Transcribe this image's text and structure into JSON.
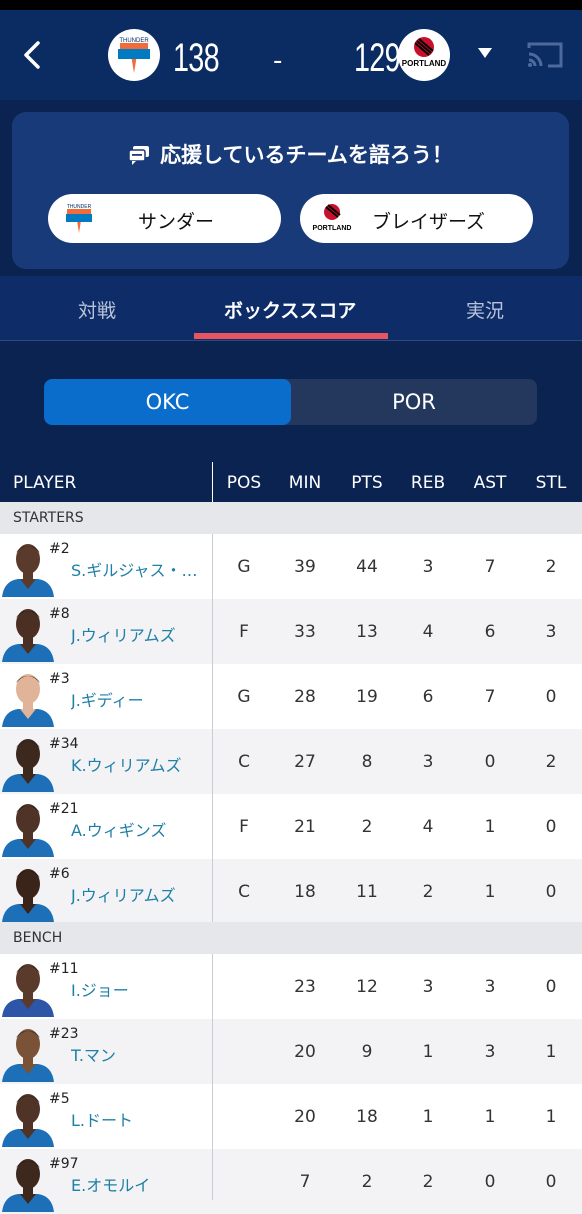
{
  "header": {
    "home_score": "138",
    "separator": "-",
    "away_score": "129",
    "home_logo_text": "THUNDER",
    "away_logo_text": "PORTLAND"
  },
  "cheer": {
    "title": "応援しているチームを語ろう！",
    "home_button": "サンダー",
    "away_button": "ブレイザーズ"
  },
  "tabs": [
    "対戦",
    "ボックススコア",
    "実況"
  ],
  "team_toggle": {
    "selected": "OKC",
    "other": "POR"
  },
  "table": {
    "columns": [
      "PLAYER",
      "POS",
      "MIN",
      "PTS",
      "REB",
      "AST",
      "STL"
    ],
    "starters_label": "STARTERS",
    "bench_label": "BENCH",
    "starters": [
      {
        "num": "#2",
        "name": "S.ギルジャス・…",
        "pos": "G",
        "min": "39",
        "pts": "44",
        "reb": "3",
        "ast": "7",
        "stl": "2",
        "skin": "#5a3a2a",
        "jersey": "#1d6fb8"
      },
      {
        "num": "#8",
        "name": "J.ウィリアムズ",
        "pos": "F",
        "min": "33",
        "pts": "13",
        "reb": "4",
        "ast": "6",
        "stl": "3",
        "skin": "#4a2f22",
        "jersey": "#1d6fb8"
      },
      {
        "num": "#3",
        "name": "J.ギディー",
        "pos": "G",
        "min": "28",
        "pts": "19",
        "reb": "6",
        "ast": "7",
        "stl": "0",
        "skin": "#e1b49a",
        "jersey": "#1d6fb8"
      },
      {
        "num": "#34",
        "name": "K.ウィリアムズ",
        "pos": "C",
        "min": "27",
        "pts": "8",
        "reb": "3",
        "ast": "0",
        "stl": "2",
        "skin": "#3d281e",
        "jersey": "#1d6fb8"
      },
      {
        "num": "#21",
        "name": "A.ウィギンズ",
        "pos": "F",
        "min": "21",
        "pts": "2",
        "reb": "4",
        "ast": "1",
        "stl": "0",
        "skin": "#4e3326",
        "jersey": "#1d6fb8"
      },
      {
        "num": "#6",
        "name": "J.ウィリアムズ",
        "pos": "C",
        "min": "18",
        "pts": "11",
        "reb": "2",
        "ast": "1",
        "stl": "0",
        "skin": "#3a241a",
        "jersey": "#1d6fb8"
      }
    ],
    "bench": [
      {
        "num": "#11",
        "name": "I.ジョー",
        "pos": "",
        "min": "23",
        "pts": "12",
        "reb": "3",
        "ast": "3",
        "stl": "0",
        "skin": "#5a3a2a",
        "jersey": "#2d55a8"
      },
      {
        "num": "#23",
        "name": "T.マン",
        "pos": "",
        "min": "20",
        "pts": "9",
        "reb": "1",
        "ast": "3",
        "stl": "1",
        "skin": "#7a5238",
        "jersey": "#1d6fb8"
      },
      {
        "num": "#5",
        "name": "L.ドート",
        "pos": "",
        "min": "20",
        "pts": "18",
        "reb": "1",
        "ast": "1",
        "stl": "1",
        "skin": "#4e3326",
        "jersey": "#1d6fb8"
      },
      {
        "num": "#97",
        "name": "E.オモルイ",
        "pos": "",
        "min": "7",
        "pts": "2",
        "reb": "2",
        "ast": "0",
        "stl": "0",
        "skin": "#3d281e",
        "jersey": "#1d6fb8"
      }
    ]
  },
  "colors": {
    "header_bg": "#0b2b63",
    "tab_indicator": "#e8545f",
    "toggle_selected": "#0a6ccb",
    "player_link": "#1f7fa6"
  }
}
